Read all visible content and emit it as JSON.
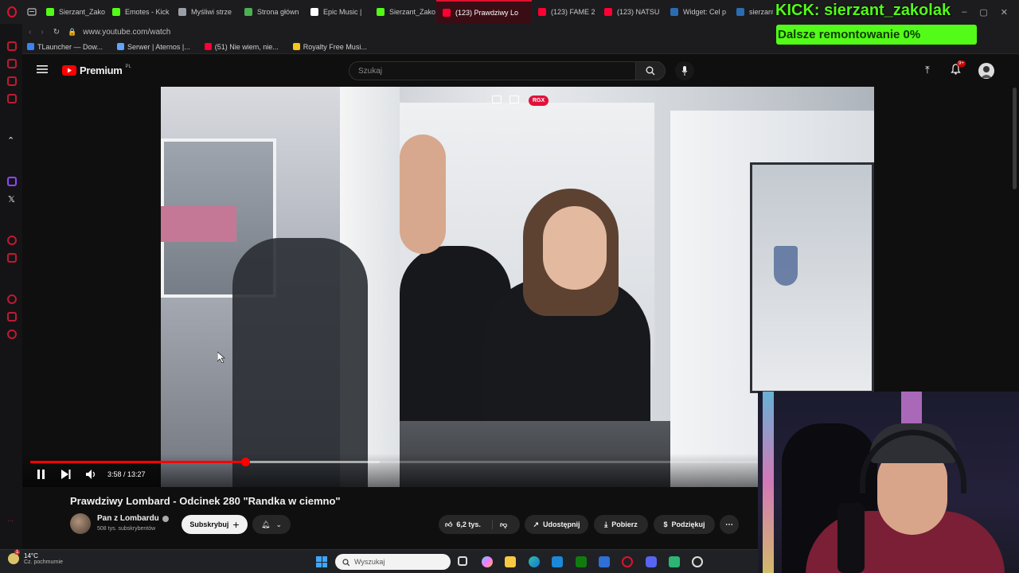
{
  "browser": {
    "tabs": [
      {
        "label": "Sierzant_Zako",
        "color": "#53fc18"
      },
      {
        "label": "Emotes - Kick",
        "color": "#53fc18"
      },
      {
        "label": "Myśliwi strze",
        "color": "#9aa0a6"
      },
      {
        "label": "Strona główn",
        "color": "#4caf50"
      },
      {
        "label": "Epic Music |",
        "color": "#ffffff"
      },
      {
        "label": "Sierzant_Zako",
        "color": "#53fc18"
      },
      {
        "label": "(123) Prawdziwy Lo",
        "color": "#ff0033",
        "active": true
      },
      {
        "label": "(123) FAME 2",
        "color": "#ff0033"
      },
      {
        "label": "(123) NATSU",
        "color": "#ff0033"
      },
      {
        "label": "Widget: Cel p",
        "color": "#2b6cb0"
      },
      {
        "label": "sierzant",
        "color": "#2b6cb0"
      }
    ],
    "url": "www.youtube.com/watch",
    "bookmarks": [
      {
        "label": "TLauncher — Dow...",
        "color": "#3b82f6"
      },
      {
        "label": "Serwer | Aternos |...",
        "color": "#60a5fa"
      },
      {
        "label": "(51) Nie wiem, nie...",
        "color": "#ff0033"
      },
      {
        "label": "Royalty Free Musi...",
        "color": "#f5c518"
      }
    ]
  },
  "overlay": {
    "kick_title": "KICK: sierzant_zakolak",
    "goal_text": "Dalsze remontowanie 0%",
    "goal_progress": 0
  },
  "youtube": {
    "brand": "Premium",
    "region": "PL",
    "search_placeholder": "Szukaj",
    "notif_badge": "9+",
    "player": {
      "rgx_label": "RGX",
      "time": "3:58 / 13:27",
      "progress": 0.295
    },
    "video_title": "Prawdziwy Lombard - Odcinek 280 \"Randka w ciemno\"",
    "channel_name": "Pan z Lombardu",
    "subscribers": "508 tys. subskrybentów",
    "subscribe_label": "Subskrybuj",
    "likes": "6,2 tys.",
    "share_label": "Udostępnij",
    "download_label": "Pobierz",
    "thanks_label": "Podziękuj"
  },
  "taskbar": {
    "temperature": "14°C",
    "weather": "Cz. pochmurnie",
    "search_placeholder": "Wyszukaj",
    "weather_badge": "1"
  }
}
